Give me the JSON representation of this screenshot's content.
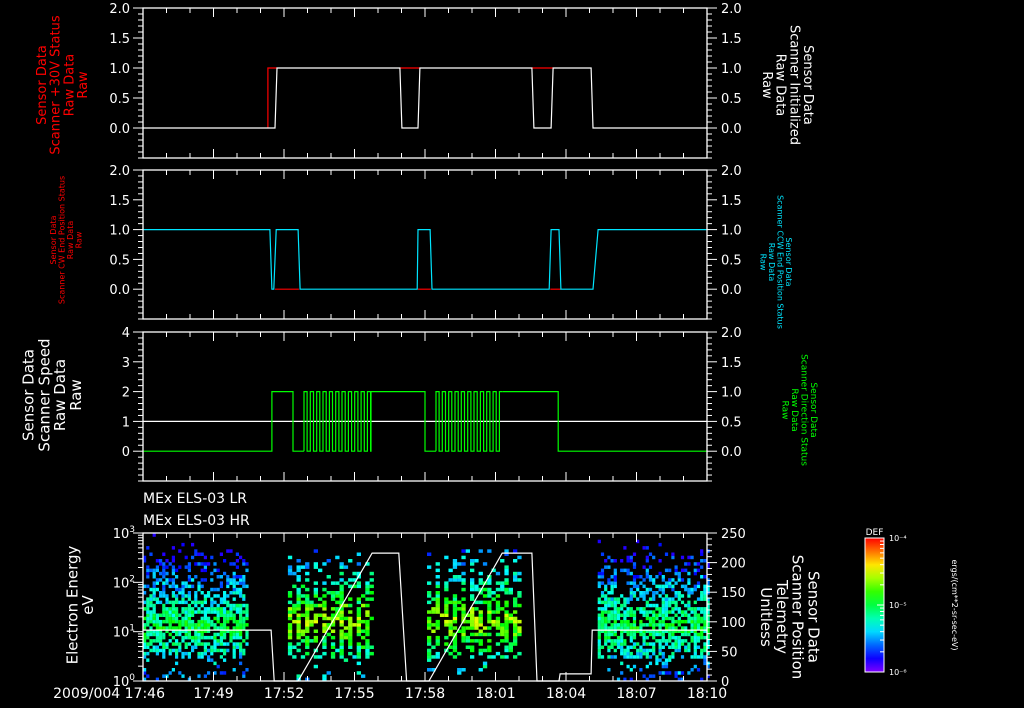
{
  "chart_data": [
    {
      "type": "line",
      "xlim": [
        "17:46:00",
        "18:10:00"
      ],
      "ylim_left": [
        -0.5,
        2.0
      ],
      "ylim_right": [
        -0.5,
        2.0
      ],
      "left_ticks": [
        "2.0",
        "1.5",
        "1.0",
        "0.5",
        "0.0"
      ],
      "right_ticks": [
        "2.0",
        "1.5",
        "1.0",
        "0.5",
        "0.0"
      ],
      "left_label": [
        "Sensor Data",
        "Scanner +30V Status",
        "Raw Data",
        "Raw"
      ],
      "right_label": [
        "Sensor Data",
        "Scanner Initialized",
        "Raw Data",
        "Raw"
      ],
      "left_label_color": "#ff0000",
      "right_label_color": "#ffffff",
      "series": [
        {
          "axis": "left",
          "color": "#ff0000",
          "segments": [
            [
              [
                "17:51:19",
                0
              ],
              [
                "17:51:19",
                1
              ],
              [
                "17:51:42",
                1
              ]
            ],
            [
              [
                "17:56:56",
                1
              ],
              [
                "17:57:47",
                1
              ]
            ],
            [
              [
                "18:02:33",
                1
              ],
              [
                "18:03:27",
                1
              ]
            ]
          ]
        },
        {
          "axis": "right",
          "color": "#ffffff",
          "segments": [
            [
              [
                "17:46:00",
                0
              ],
              [
                "17:51:37",
                0
              ],
              [
                "17:51:42",
                1
              ],
              [
                "17:56:56",
                1
              ],
              [
                "17:57:01",
                0
              ],
              [
                "17:57:42",
                0
              ],
              [
                "17:57:47",
                1
              ],
              [
                "18:02:33",
                1
              ],
              [
                "18:02:38",
                0
              ],
              [
                "18:03:22",
                0
              ],
              [
                "18:03:27",
                1
              ],
              [
                "18:05:04",
                1
              ],
              [
                "18:05:09",
                0
              ],
              [
                "18:10:00",
                0
              ]
            ]
          ]
        }
      ]
    },
    {
      "type": "line",
      "xlim": [
        "17:46:00",
        "18:10:00"
      ],
      "ylim_left": [
        -0.5,
        2.0
      ],
      "ylim_right": [
        -0.5,
        2.0
      ],
      "left_ticks": [
        "2.0",
        "1.5",
        "1.0",
        "0.5",
        "0.0"
      ],
      "right_ticks": [
        "2.0",
        "1.5",
        "1.0",
        "0.5",
        "0.0"
      ],
      "left_label": [
        "Sensor Data",
        "Scanner CW End Position Status",
        "Raw Data",
        "Raw"
      ],
      "right_label": [
        "Sensor Data",
        "Scanner CCW End Position Status",
        "Raw Data",
        "Raw"
      ],
      "left_label_color": "#ff0000",
      "right_label_color": "#00e5ff",
      "series": [
        {
          "axis": "left",
          "color": "#ff0000",
          "segments": [
            [
              [
                "17:51:37",
                0
              ],
              [
                "17:52:38",
                0
              ]
            ],
            [
              [
                "17:57:42",
                0
              ],
              [
                "17:58:15",
                0
              ]
            ],
            [
              [
                "18:03:20",
                0
              ],
              [
                "18:03:47",
                0
              ]
            ]
          ]
        },
        {
          "axis": "right",
          "color": "#00e5ff",
          "segments": [
            [
              [
                "17:46:00",
                1
              ],
              [
                "17:51:24",
                1
              ],
              [
                "17:51:29",
                0
              ],
              [
                "17:51:34",
                0
              ],
              [
                "17:51:40",
                1
              ],
              [
                "17:52:36",
                1
              ],
              [
                "17:52:41",
                0
              ],
              [
                "17:57:40",
                0
              ],
              [
                "17:57:42",
                1
              ],
              [
                "17:58:13",
                1
              ],
              [
                "17:58:18",
                0
              ],
              [
                "18:03:17",
                0
              ],
              [
                "18:03:22",
                1
              ],
              [
                "18:03:42",
                1
              ],
              [
                "18:03:47",
                0
              ],
              [
                "18:05:09",
                0
              ],
              [
                "18:05:22",
                1
              ],
              [
                "18:10:00",
                1
              ]
            ]
          ]
        }
      ]
    },
    {
      "type": "line",
      "xlim": [
        "17:46:00",
        "18:10:00"
      ],
      "ylim_left": [
        -1,
        4
      ],
      "ylim_right": [
        -0.5,
        2.0
      ],
      "left_ticks": [
        "4",
        "3",
        "2",
        "1",
        "0"
      ],
      "right_ticks": [
        "2.0",
        "1.5",
        "1.0",
        "0.5",
        "0.0"
      ],
      "left_label": [
        "Sensor Data",
        "Scanner Speed",
        "Raw Data",
        "Raw"
      ],
      "right_label": [
        "Sensor Data",
        "Scanner Direction Status",
        "Raw Data",
        "Raw"
      ],
      "left_label_color": "#ffffff",
      "right_label_color": "#00ff00",
      "series": [
        {
          "axis": "left",
          "color": "#ffffff",
          "segments": [
            [
              [
                "17:46:00",
                1
              ],
              [
                "18:10:00",
                1
              ]
            ]
          ]
        },
        {
          "axis": "right",
          "color": "#00ff00",
          "segments": [
            [
              [
                "17:46:00",
                0
              ],
              [
                "17:51:29",
                0
              ],
              [
                "17:51:29",
                1
              ],
              [
                "17:52:23",
                1
              ],
              [
                "17:52:23",
                0
              ],
              [
                "17:52:51",
                0
              ]
            ],
            [
              [
                "17:55:42",
                1
              ],
              [
                "17:58:00",
                1
              ],
              [
                "17:58:00",
                0
              ],
              [
                "17:58:28",
                0
              ]
            ],
            [
              [
                "18:01:17",
                1
              ],
              [
                "18:03:40",
                1
              ],
              [
                "18:03:40",
                0
              ],
              [
                "18:10:00",
                0
              ]
            ]
          ],
          "alternating_intervals": [
            [
              "17:52:51",
              "17:55:42"
            ],
            [
              "17:58:28",
              "18:01:17"
            ]
          ]
        }
      ]
    },
    {
      "type": "heatmap",
      "titles": [
        "MEx ELS-03 LR",
        "MEx ELS-03 HR"
      ],
      "xlim": [
        "17:46:00",
        "18:10:00"
      ],
      "ylim_left": [
        1,
        1000
      ],
      "y_scale_left": "log",
      "ylim_right": [
        0,
        250
      ],
      "left_ticks": [
        "10",
        "10",
        "10",
        "10"
      ],
      "left_tick_exponents": [
        "3",
        "2",
        "1",
        "0"
      ],
      "right_ticks": [
        "250",
        "200",
        "150",
        "100",
        "50",
        "0"
      ],
      "left_label": [
        "Electron Energy",
        "eV"
      ],
      "right_label": [
        "Sensor Data",
        "Scanner Position",
        "Telemetry",
        "Unitless"
      ],
      "data_intervals": [
        [
          "17:46:00",
          "17:50:23"
        ],
        [
          "17:52:10",
          "17:55:45"
        ],
        [
          "17:58:05",
          "18:01:57"
        ],
        [
          "18:05:21",
          "18:10:00"
        ]
      ],
      "peak_energy_eV": 12,
      "colorbar": {
        "label": "DEF",
        "ticks": [
          "10⁻⁴",
          "10⁻⁵",
          "10⁻⁶"
        ],
        "range_log": [
          -6,
          -4
        ],
        "units": "ergs/(cm**2-sr-sec-eV)",
        "colormap": "rainbow"
      },
      "series": [
        {
          "axis": "right",
          "color": "#ffffff",
          "segments": [
            [
              [
                "17:46:00",
                86
              ],
              [
                "17:51:27",
                86
              ],
              [
                "17:51:35",
                0
              ],
              [
                "17:52:36",
                0
              ],
              [
                "17:55:45",
                216
              ],
              [
                "17:56:53",
                216
              ],
              [
                "17:57:13",
                0
              ],
              [
                "17:58:10",
                0
              ],
              [
                "18:01:17",
                216
              ],
              [
                "18:02:33",
                216
              ],
              [
                "18:02:46",
                0
              ],
              [
                "18:03:42",
                0
              ],
              [
                "18:03:45",
                12
              ],
              [
                "18:05:04",
                12
              ],
              [
                "18:05:07",
                86
              ],
              [
                "18:10:00",
                86
              ]
            ]
          ]
        }
      ]
    }
  ],
  "x_axis": {
    "date": "2009/004",
    "tick_labels": [
      "17:46",
      "17:49",
      "17:52",
      "17:55",
      "17:58",
      "18:01",
      "18:04",
      "18:07",
      "18:10"
    ]
  }
}
